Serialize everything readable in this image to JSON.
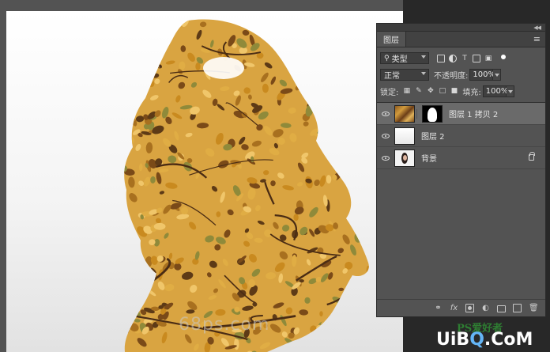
{
  "canvas": {
    "watermark": "68ps.com",
    "background_top": "#ffffff",
    "background_bottom": "#e2e2e2"
  },
  "layers_panel": {
    "tab_label": "图层",
    "menu_icon": "panel-menu-icon",
    "filter": {
      "kind_label": "类型",
      "icons": [
        "image-filter-icon",
        "adjustment-filter-icon",
        "text-filter-icon",
        "shape-filter-icon",
        "smart-object-filter-icon"
      ]
    },
    "blend": {
      "mode": "正常",
      "opacity_label": "不透明度:",
      "opacity_value": "100%"
    },
    "lock": {
      "label": "锁定:",
      "icons": [
        "lock-pixels-icon",
        "lock-paint-icon",
        "lock-position-icon",
        "lock-artboard-icon",
        "lock-all-icon"
      ],
      "fill_label": "填充:",
      "fill_value": "100%"
    },
    "layers": [
      {
        "name": "图层 1 拷贝 2",
        "visible": true,
        "selected": true,
        "has_mask": true
      },
      {
        "name": "图层 2",
        "visible": true,
        "selected": false,
        "has_mask": false
      },
      {
        "name": "背景",
        "visible": true,
        "selected": false,
        "has_mask": false,
        "locked": true
      }
    ],
    "footer_icons": [
      "link-layers-icon",
      "fx-icon",
      "add-mask-icon",
      "adjustment-layer-icon",
      "new-group-icon",
      "new-layer-icon",
      "delete-icon"
    ],
    "footer_fx_label": "fx"
  },
  "logo": {
    "top_text": "PS爱好者",
    "main_left": "UiB",
    "main_accent": "Q",
    "main_right": ".CoM"
  },
  "colors": {
    "workspace": "#535353",
    "panel": "#535353",
    "selected_layer": "#6a6a6a",
    "leaf_gold": "#c98a1f",
    "leaf_brown": "#7a4a18",
    "branch": "#4a2c14"
  }
}
